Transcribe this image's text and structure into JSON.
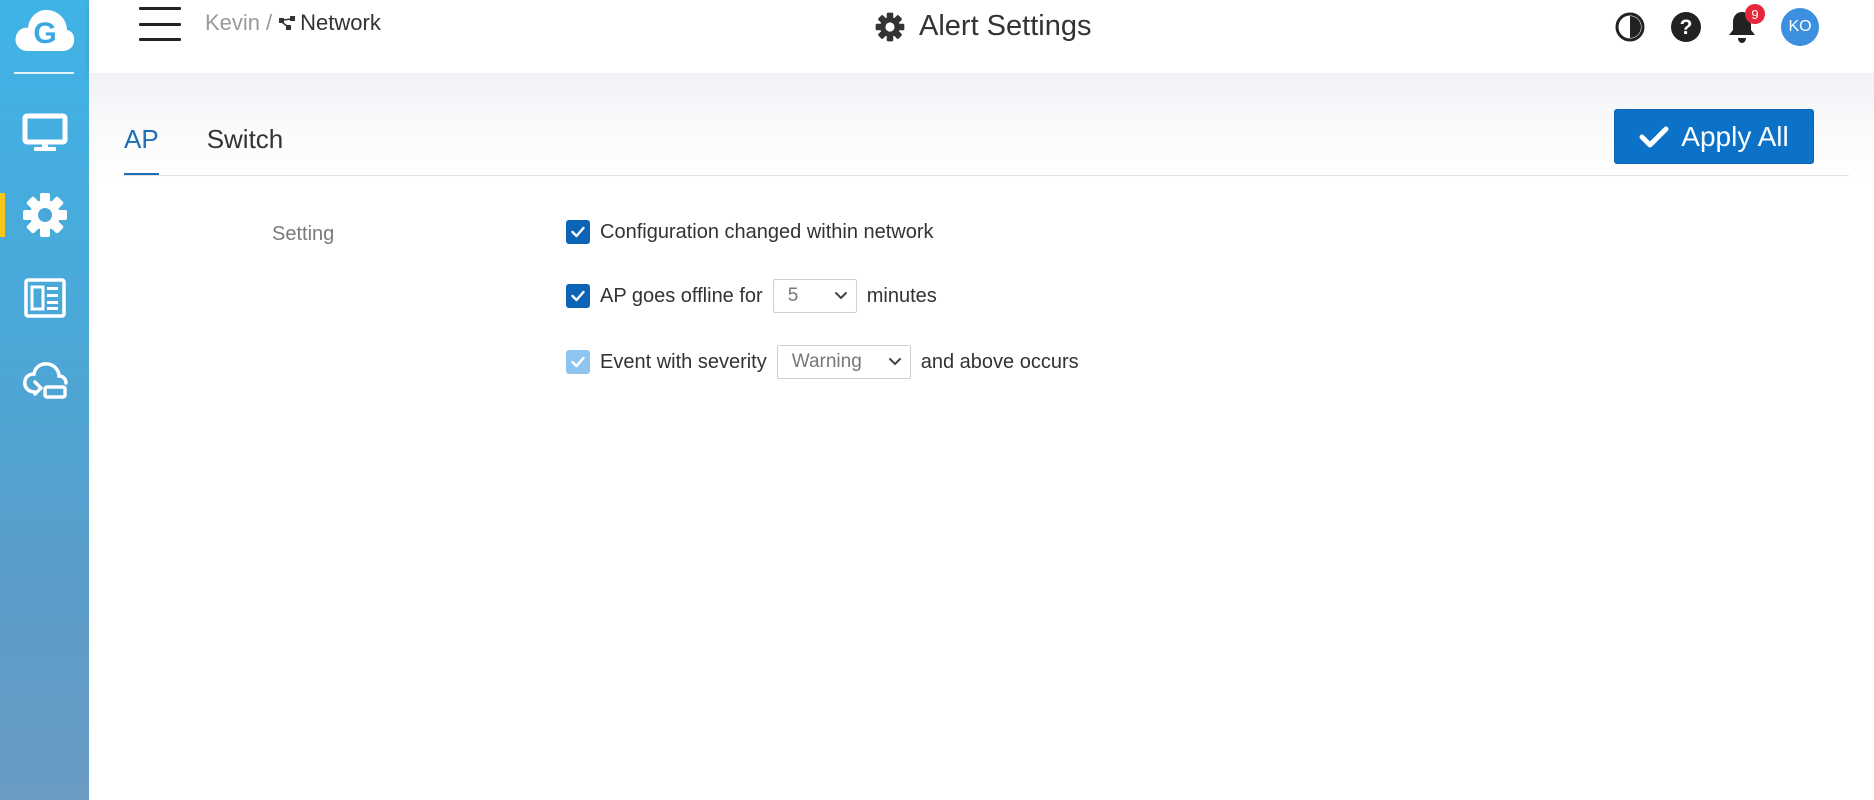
{
  "breadcrumb": {
    "user": "Kevin",
    "separator": "/",
    "network": "Network"
  },
  "page": {
    "title": "Alert Settings"
  },
  "header": {
    "notification_count": "9",
    "avatar_initials": "KO"
  },
  "tabs": [
    {
      "label": "AP"
    },
    {
      "label": "Switch"
    }
  ],
  "actions": {
    "apply_all": "Apply All"
  },
  "settings": {
    "section_label": "Setting",
    "config_changed": "Configuration changed within network",
    "ap_offline_prefix": "AP goes offline for",
    "ap_offline_value": "5",
    "ap_offline_suffix": "minutes",
    "severity_prefix": "Event with severity",
    "severity_value": "Warning",
    "severity_suffix": "and above occurs"
  },
  "colors": {
    "accent": "#0b72c8",
    "active_marker": "#f5c518",
    "badge": "#e6263a"
  }
}
